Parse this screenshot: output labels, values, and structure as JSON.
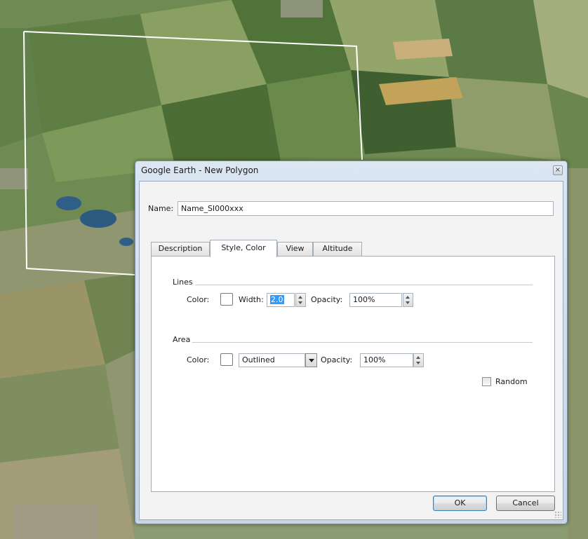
{
  "window": {
    "title": "Google Earth - New Polygon",
    "close_glyph": "×"
  },
  "name_field": {
    "label": "Name:",
    "value": "Name_SI000xxx"
  },
  "tabs": [
    {
      "label": "Description",
      "active": false
    },
    {
      "label": "Style, Color",
      "active": true
    },
    {
      "label": "View",
      "active": false
    },
    {
      "label": "Altitude",
      "active": false
    }
  ],
  "lines": {
    "group_label": "Lines",
    "color_label": "Color:",
    "color": "#ffffff",
    "width_label": "Width:",
    "width_value": "2.0",
    "opacity_label": "Opacity:",
    "opacity_value": "100%"
  },
  "area": {
    "group_label": "Area",
    "color_label": "Color:",
    "color": "#ffffff",
    "fill_mode": "Outlined",
    "opacity_label": "Opacity:",
    "opacity_value": "100%"
  },
  "random": {
    "label": "Random",
    "checked": false
  },
  "buttons": {
    "ok": "OK",
    "cancel": "Cancel"
  },
  "colors": {
    "polygon_outline": "#ffffff",
    "selection": "#3399ff",
    "default_button_border": "#3c7fb1"
  },
  "icons": [
    "close-icon",
    "spin-up-icon",
    "spin-down-icon",
    "chevron-down-icon",
    "resize-grip-icon"
  ]
}
